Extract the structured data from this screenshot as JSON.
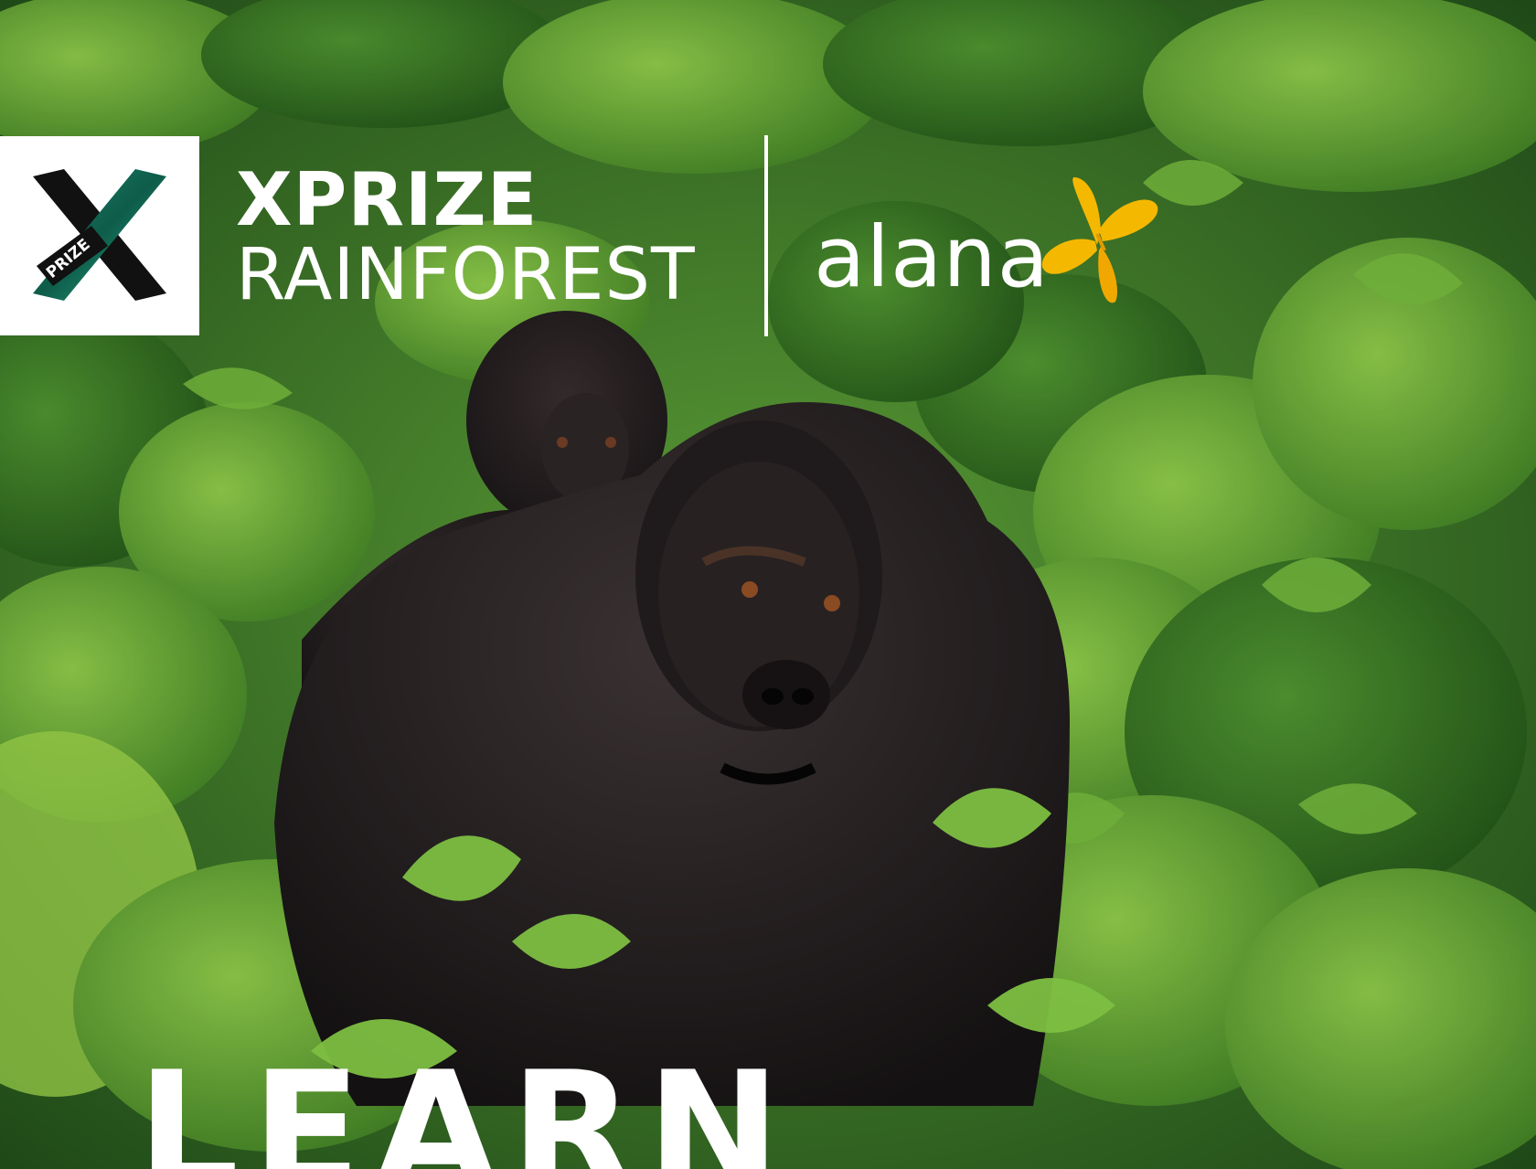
{
  "logo": {
    "mark_text": "PRIZE",
    "line1": "XPRIZE",
    "line2": "RAINFOREST"
  },
  "partner": {
    "name": "alana",
    "icon": "butterfly-icon",
    "icon_color": "#f5b800"
  },
  "headline": "LEARN",
  "colors": {
    "foliage": "#3f7f2a",
    "text": "#ffffff"
  }
}
